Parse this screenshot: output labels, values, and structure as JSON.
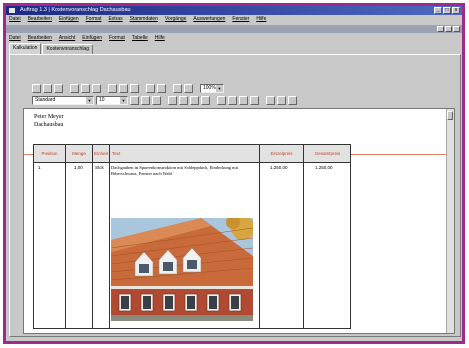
{
  "window": {
    "title": "Auftrag 1.3 | Kostenvoranschlag Dachausbau",
    "buttons": [
      "_",
      "□",
      "x"
    ]
  },
  "menubar": [
    "Datei",
    "Bearbeiten",
    "Einfügen",
    "Format",
    "Extras",
    "Stammdaten",
    "Vorgänge",
    "Auswertungen",
    "Fenster",
    "Hilfe"
  ],
  "submenu": [
    "Datei",
    "Bearbeiten",
    "Ansicht",
    "Einfügen",
    "Format",
    "Tabelle",
    "Hilfe"
  ],
  "tabs": [
    "Kalkulation",
    "Kostenvoranschlag"
  ],
  "toolbar": {
    "style_value": "Standard",
    "size_value": "10",
    "zoom_value": "100%"
  },
  "document": {
    "address_line1": "Peter Meyer",
    "address_line2": "Dachausbau",
    "table_headers": [
      "Position",
      "Menge",
      "Einheit",
      "Text",
      "Einzelpreis",
      "Gesamtpreis"
    ],
    "row": {
      "position": "1",
      "quantity": "1,00",
      "unit": "Stck",
      "text": "Dachgauben in Sparrenkonstruktion mit Schleppdach, Eindeckung mit Biberschwanz, Fenster nach Wahl",
      "unit_price": "1.250,00",
      "total_price": "1.250,00"
    }
  },
  "colors": {
    "frame": "#a02a8a",
    "titlebar": "#1d2a86",
    "header_text": "#c0451f",
    "red_rule": "#e48060"
  }
}
